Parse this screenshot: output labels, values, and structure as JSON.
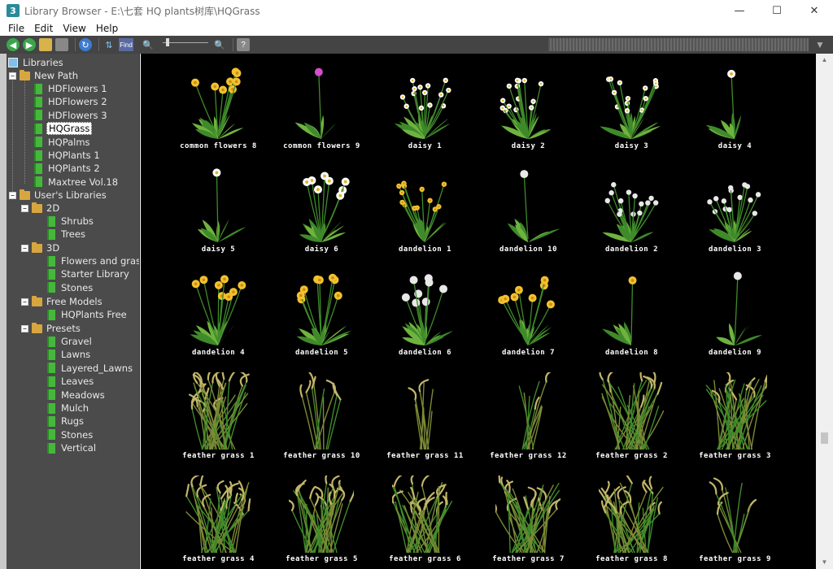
{
  "window": {
    "title": "Library Browser - E:\\七套 HQ plants树库\\HQGrass",
    "app_icon": "3",
    "minimize": "—",
    "maximize": "☐",
    "close": "✕"
  },
  "menu": [
    "File",
    "Edit",
    "View",
    "Help"
  ],
  "toolbar": {
    "find_label": "Find",
    "icons": [
      "back-icon",
      "forward-icon",
      "open-folder-icon",
      "stop-icon",
      "refresh-icon",
      "tree-icon",
      "find-icon",
      "zoom-out-icon",
      "zoom-in-icon",
      "help-icon",
      "filter-icon"
    ]
  },
  "tree": {
    "root": "Libraries",
    "new_path": "New Path",
    "new_path_items": [
      "HDFlowers 1",
      "HDFlowers 2",
      "HDFlowers 3",
      "HQGrass",
      "HQPalms",
      "HQPlants 1",
      "HQPlants 2",
      "Maxtree Vol.18"
    ],
    "selected": "HQGrass",
    "user_libraries": "User's Libraries",
    "folder_2d": "2D",
    "items_2d": [
      "Shrubs",
      "Trees"
    ],
    "folder_3d": "3D",
    "items_3d": [
      "Flowers and grass",
      "Starter Library",
      "Stones"
    ],
    "folder_free": "Free Models",
    "items_free": [
      "HQPlants Free"
    ],
    "folder_presets": "Presets",
    "items_presets": [
      "Gravel",
      "Lawns",
      "Layered_Lawns",
      "Leaves",
      "Meadows",
      "Mulch",
      "Rugs",
      "Stones",
      "Vertical"
    ]
  },
  "items": [
    {
      "name": "common flowers 8",
      "flower": "#f2c12e",
      "kind": "flowers"
    },
    {
      "name": "common flowers 9",
      "flower": "#d34ec9",
      "kind": "single"
    },
    {
      "name": "daisy 1",
      "flower": "#ffffff",
      "kind": "bush"
    },
    {
      "name": "daisy 2",
      "flower": "#ffffff",
      "kind": "bush"
    },
    {
      "name": "daisy 3",
      "flower": "#ffffff",
      "kind": "bush"
    },
    {
      "name": "daisy 4",
      "flower": "#ffffff",
      "kind": "single"
    },
    {
      "name": "daisy 5",
      "flower": "#ffffff",
      "kind": "single"
    },
    {
      "name": "daisy 6",
      "flower": "#ffffff",
      "kind": "flowers"
    },
    {
      "name": "dandelion 1",
      "flower": "#f2c12e",
      "kind": "bush"
    },
    {
      "name": "dandelion 10",
      "flower": "#e8e8e8",
      "kind": "single"
    },
    {
      "name": "dandelion 2",
      "flower": "#e8e8e8",
      "kind": "bush"
    },
    {
      "name": "dandelion 3",
      "flower": "#e8e8e8",
      "kind": "bush"
    },
    {
      "name": "dandelion 4",
      "flower": "#f2c12e",
      "kind": "flowers"
    },
    {
      "name": "dandelion 5",
      "flower": "#f2c12e",
      "kind": "flowers"
    },
    {
      "name": "dandelion 6",
      "flower": "#e8e8e8",
      "kind": "flowers"
    },
    {
      "name": "dandelion 7",
      "flower": "#f2c12e",
      "kind": "flowers"
    },
    {
      "name": "dandelion 8",
      "flower": "#f2c12e",
      "kind": "single"
    },
    {
      "name": "dandelion 9",
      "flower": "#e8e8e8",
      "kind": "single"
    },
    {
      "name": "feather grass 1",
      "flower": "#8a8f3a",
      "kind": "grass"
    },
    {
      "name": "feather grass 10",
      "flower": "#8a8f3a",
      "kind": "sparse"
    },
    {
      "name": "feather grass 11",
      "flower": "#8a8f3a",
      "kind": "sparse"
    },
    {
      "name": "feather grass 12",
      "flower": "#8a8f3a",
      "kind": "sparse"
    },
    {
      "name": "feather grass 2",
      "flower": "#8a8f3a",
      "kind": "grass"
    },
    {
      "name": "feather grass 3",
      "flower": "#8a8f3a",
      "kind": "grass"
    },
    {
      "name": "feather grass 4",
      "flower": "#8a8f3a",
      "kind": "grass"
    },
    {
      "name": "feather grass 5",
      "flower": "#8a8f3a",
      "kind": "grass"
    },
    {
      "name": "feather grass 6",
      "flower": "#8a8f3a",
      "kind": "grass"
    },
    {
      "name": "feather grass 7",
      "flower": "#8a8f3a",
      "kind": "grass"
    },
    {
      "name": "feather grass 8",
      "flower": "#8a8f3a",
      "kind": "grass"
    },
    {
      "name": "feather grass 9",
      "flower": "#8a8f3a",
      "kind": "sparse"
    }
  ],
  "colors": {
    "leaf": "#3f8a2a",
    "leaf_light": "#6fb33f",
    "panel_bg": "#000000",
    "sidebar_bg": "#4b4b4b",
    "toolbar_bg": "#444444"
  }
}
